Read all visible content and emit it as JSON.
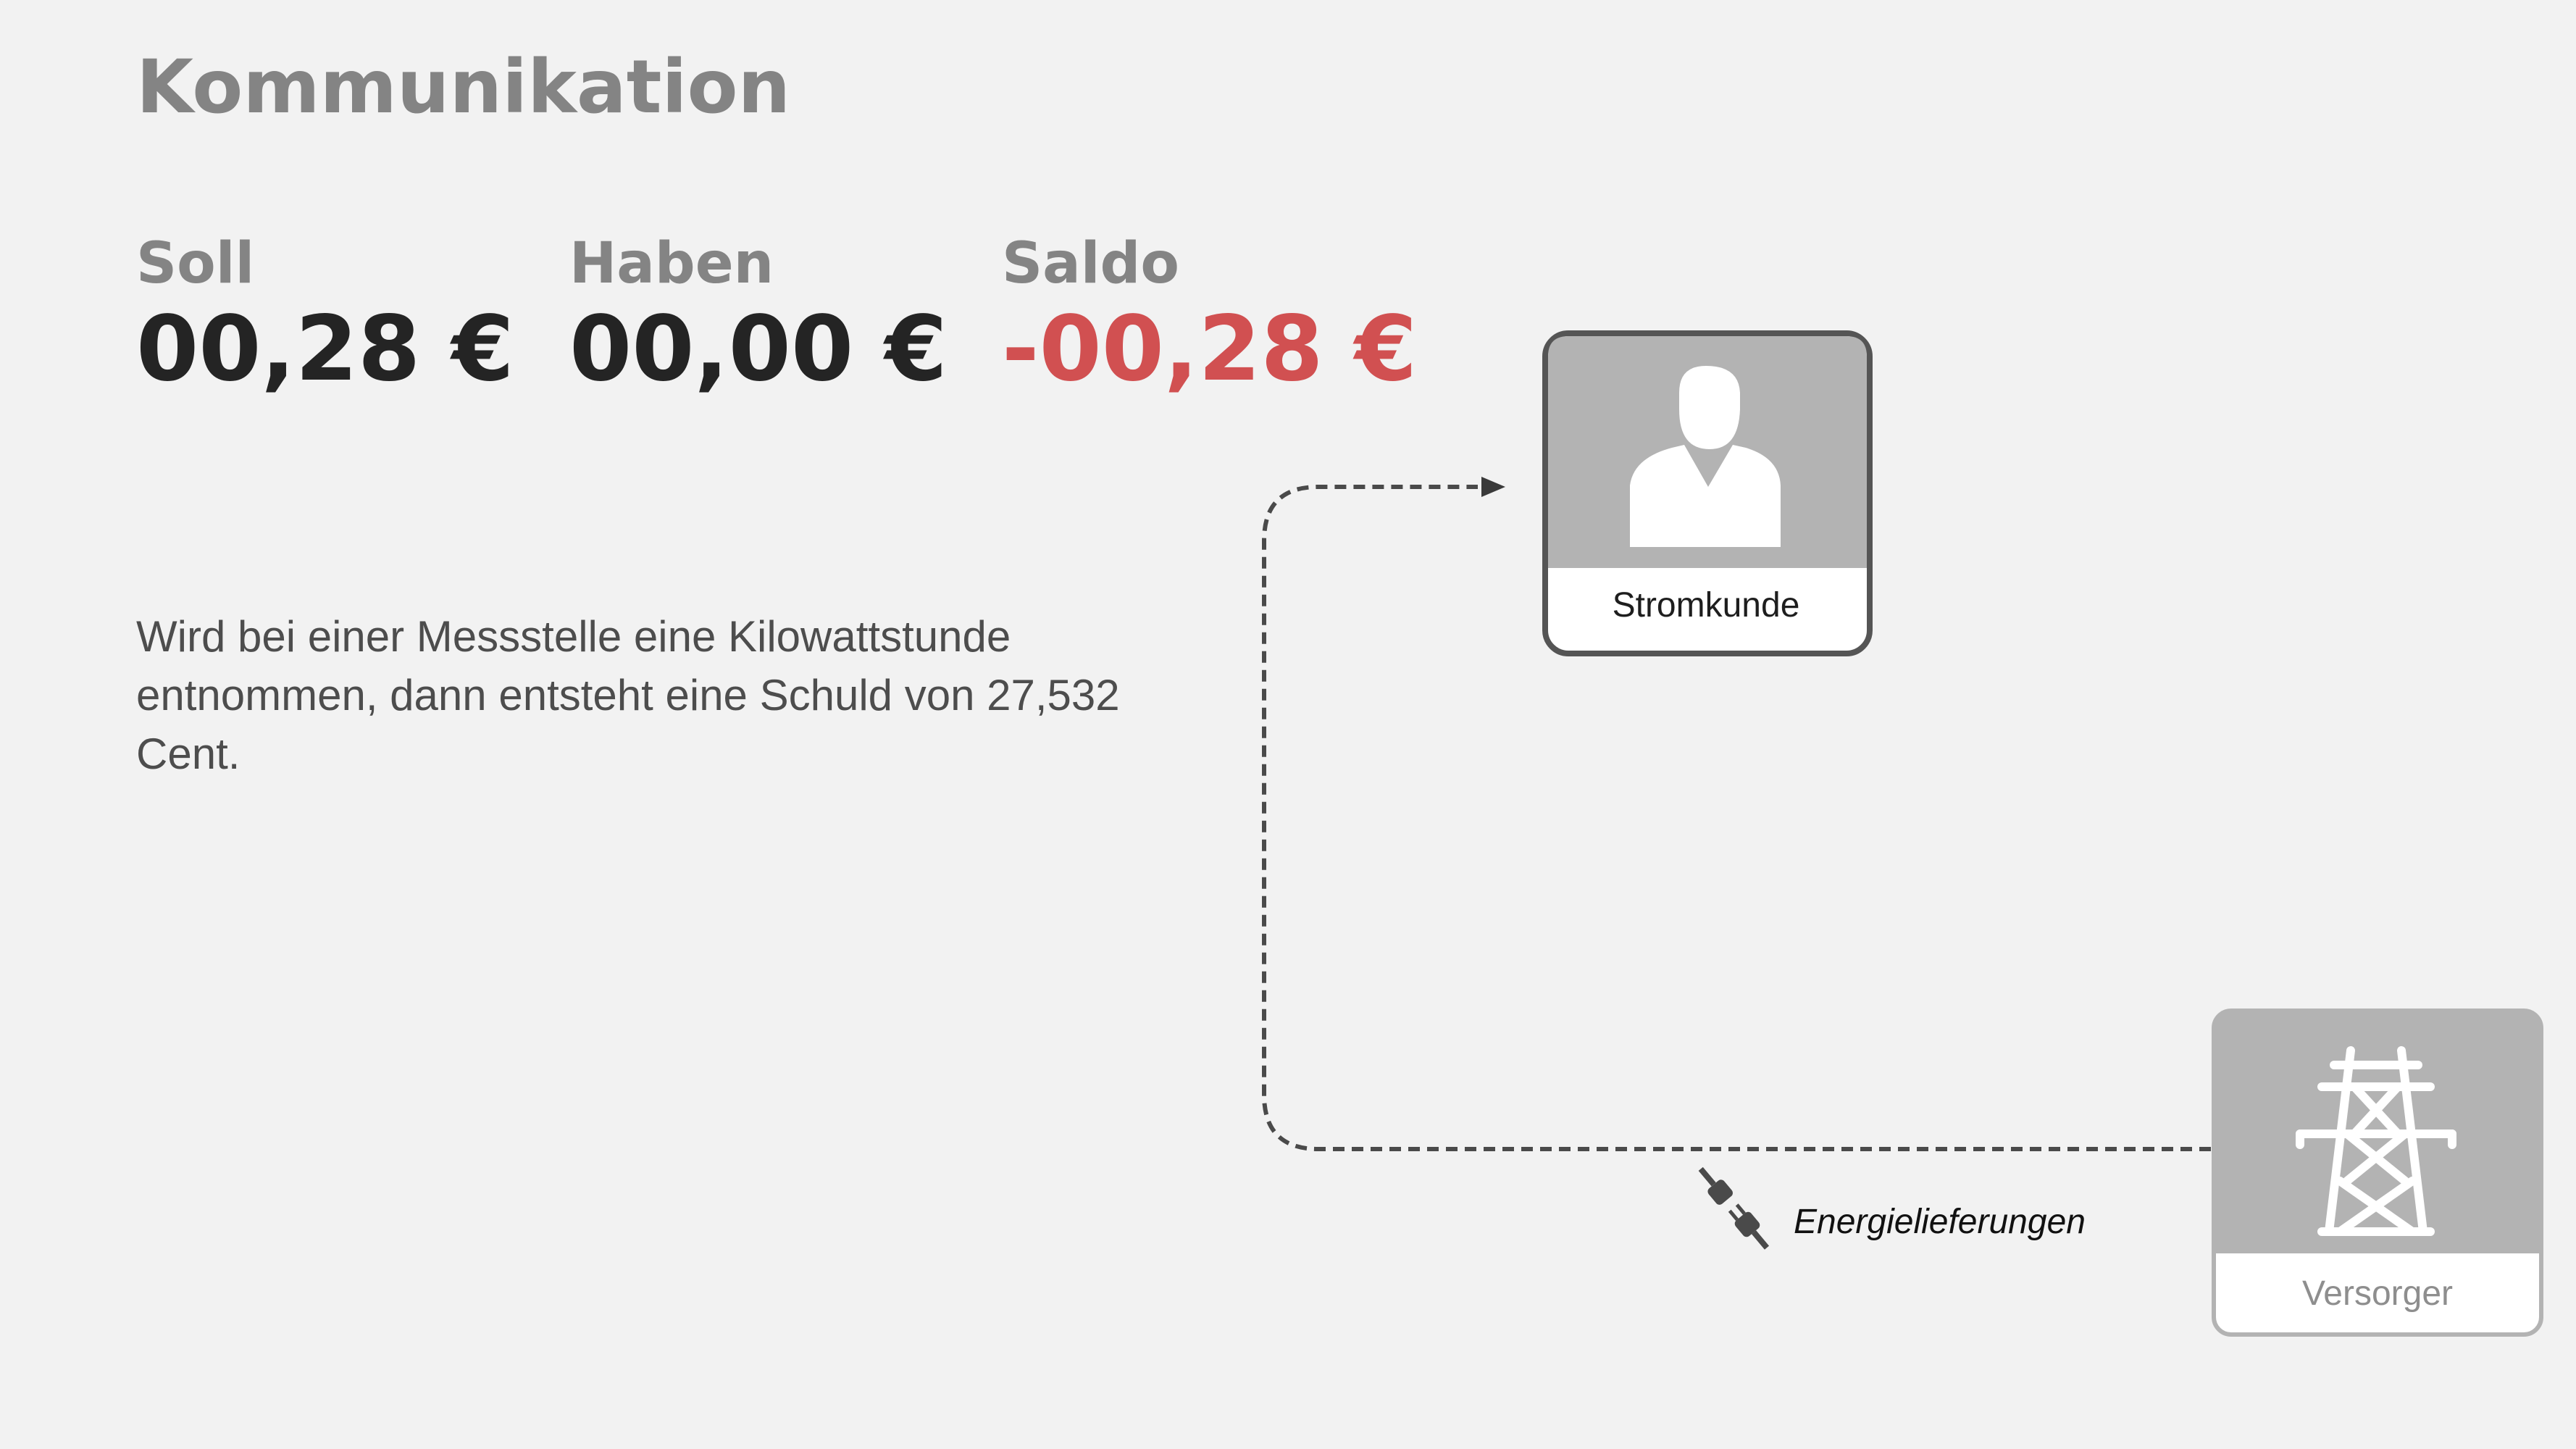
{
  "header": {
    "title": "Kommunikation"
  },
  "accounts": [
    {
      "label": "Soll",
      "value": "00,28 €"
    },
    {
      "label": "Haben",
      "value": "00,00 €"
    },
    {
      "label": "Saldo",
      "value": "-00,28 €",
      "status_color": "#d15051"
    }
  ],
  "description": "Wird bei einer Messstelle eine Kilowattstunde entnommen, dann entsteht eine Schuld von 27,532 Cent.",
  "diagram": {
    "nodes": {
      "customer": {
        "label": "Stromkunde",
        "icon": "person-icon"
      },
      "supplier": {
        "label": "Versorger",
        "icon": "power-tower-icon"
      }
    },
    "edge": {
      "label": "Energielieferungen",
      "icon": "plug-icon",
      "from": "Versorger",
      "to": "Stromkunde"
    }
  },
  "colors": {
    "background": "#f2f2f2",
    "heading_gray": "#848484",
    "negative": "#d15051",
    "node_fill": "#b3b3b3"
  }
}
